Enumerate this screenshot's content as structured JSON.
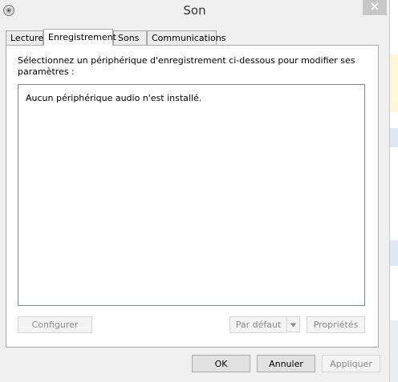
{
  "window": {
    "title": "Son"
  },
  "tabs": [
    {
      "label": "Lecture"
    },
    {
      "label": "Enregistrement"
    },
    {
      "label": "Sons"
    },
    {
      "label": "Communications"
    }
  ],
  "recording": {
    "instruction": "Sélectionnez un périphérique d'enregistrement ci-dessous pour modifier ses paramètres :",
    "empty_message": "Aucun périphérique audio n'est installé.",
    "configure_label": "Configurer",
    "default_label": "Par défaut",
    "properties_label": "Propriétés"
  },
  "footer": {
    "ok_label": "OK",
    "cancel_label": "Annuler",
    "apply_label": "Appliquer"
  },
  "icons": {
    "app": "speaker-icon",
    "close": "close-icon",
    "dropdown": "chevron-down-icon"
  },
  "colors": {
    "background": "#f0f0f0",
    "panel": "#ffffff",
    "border": "#a8a8a8",
    "disabled_text": "#8a8a8a",
    "close_button": "#c7c7c7"
  }
}
